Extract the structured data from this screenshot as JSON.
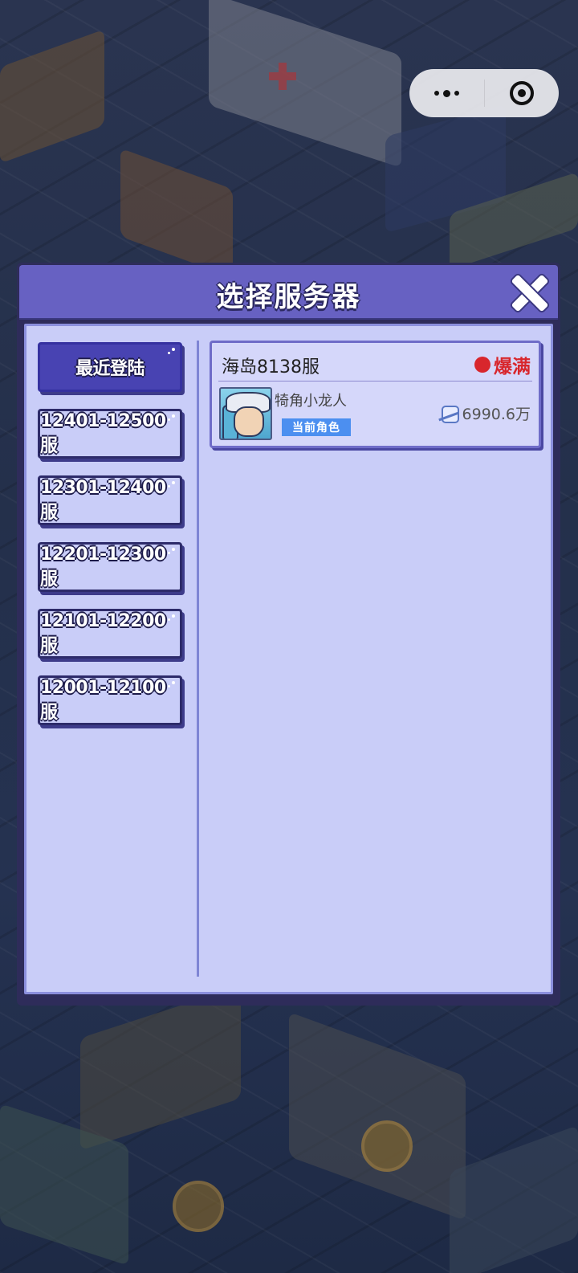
{
  "capsule": {
    "more_icon": "more-dots-icon",
    "close_icon": "target-circle-icon"
  },
  "dialog": {
    "title": "选择服务器",
    "close_icon": "close-x-icon"
  },
  "tabs": [
    {
      "label": "最近登陆",
      "active": true
    },
    {
      "label": "12401-12500服",
      "active": false
    },
    {
      "label": "12301-12400服",
      "active": false
    },
    {
      "label": "12201-12300服",
      "active": false
    },
    {
      "label": "12101-12200服",
      "active": false
    },
    {
      "label": "12001-12100服",
      "active": false
    }
  ],
  "server": {
    "name": "海岛8138服",
    "status": "爆满",
    "status_color": "#d8262c",
    "character": {
      "name": "犄角小龙人",
      "badge": "当前角色",
      "power": "6990.6万",
      "power_icon": "fist-power-icon"
    }
  },
  "colors": {
    "dialog_header": "#6761c2",
    "body_bg": "#c9cdf8",
    "active_tab": "#4843b2",
    "badge": "#4c8ff0"
  }
}
